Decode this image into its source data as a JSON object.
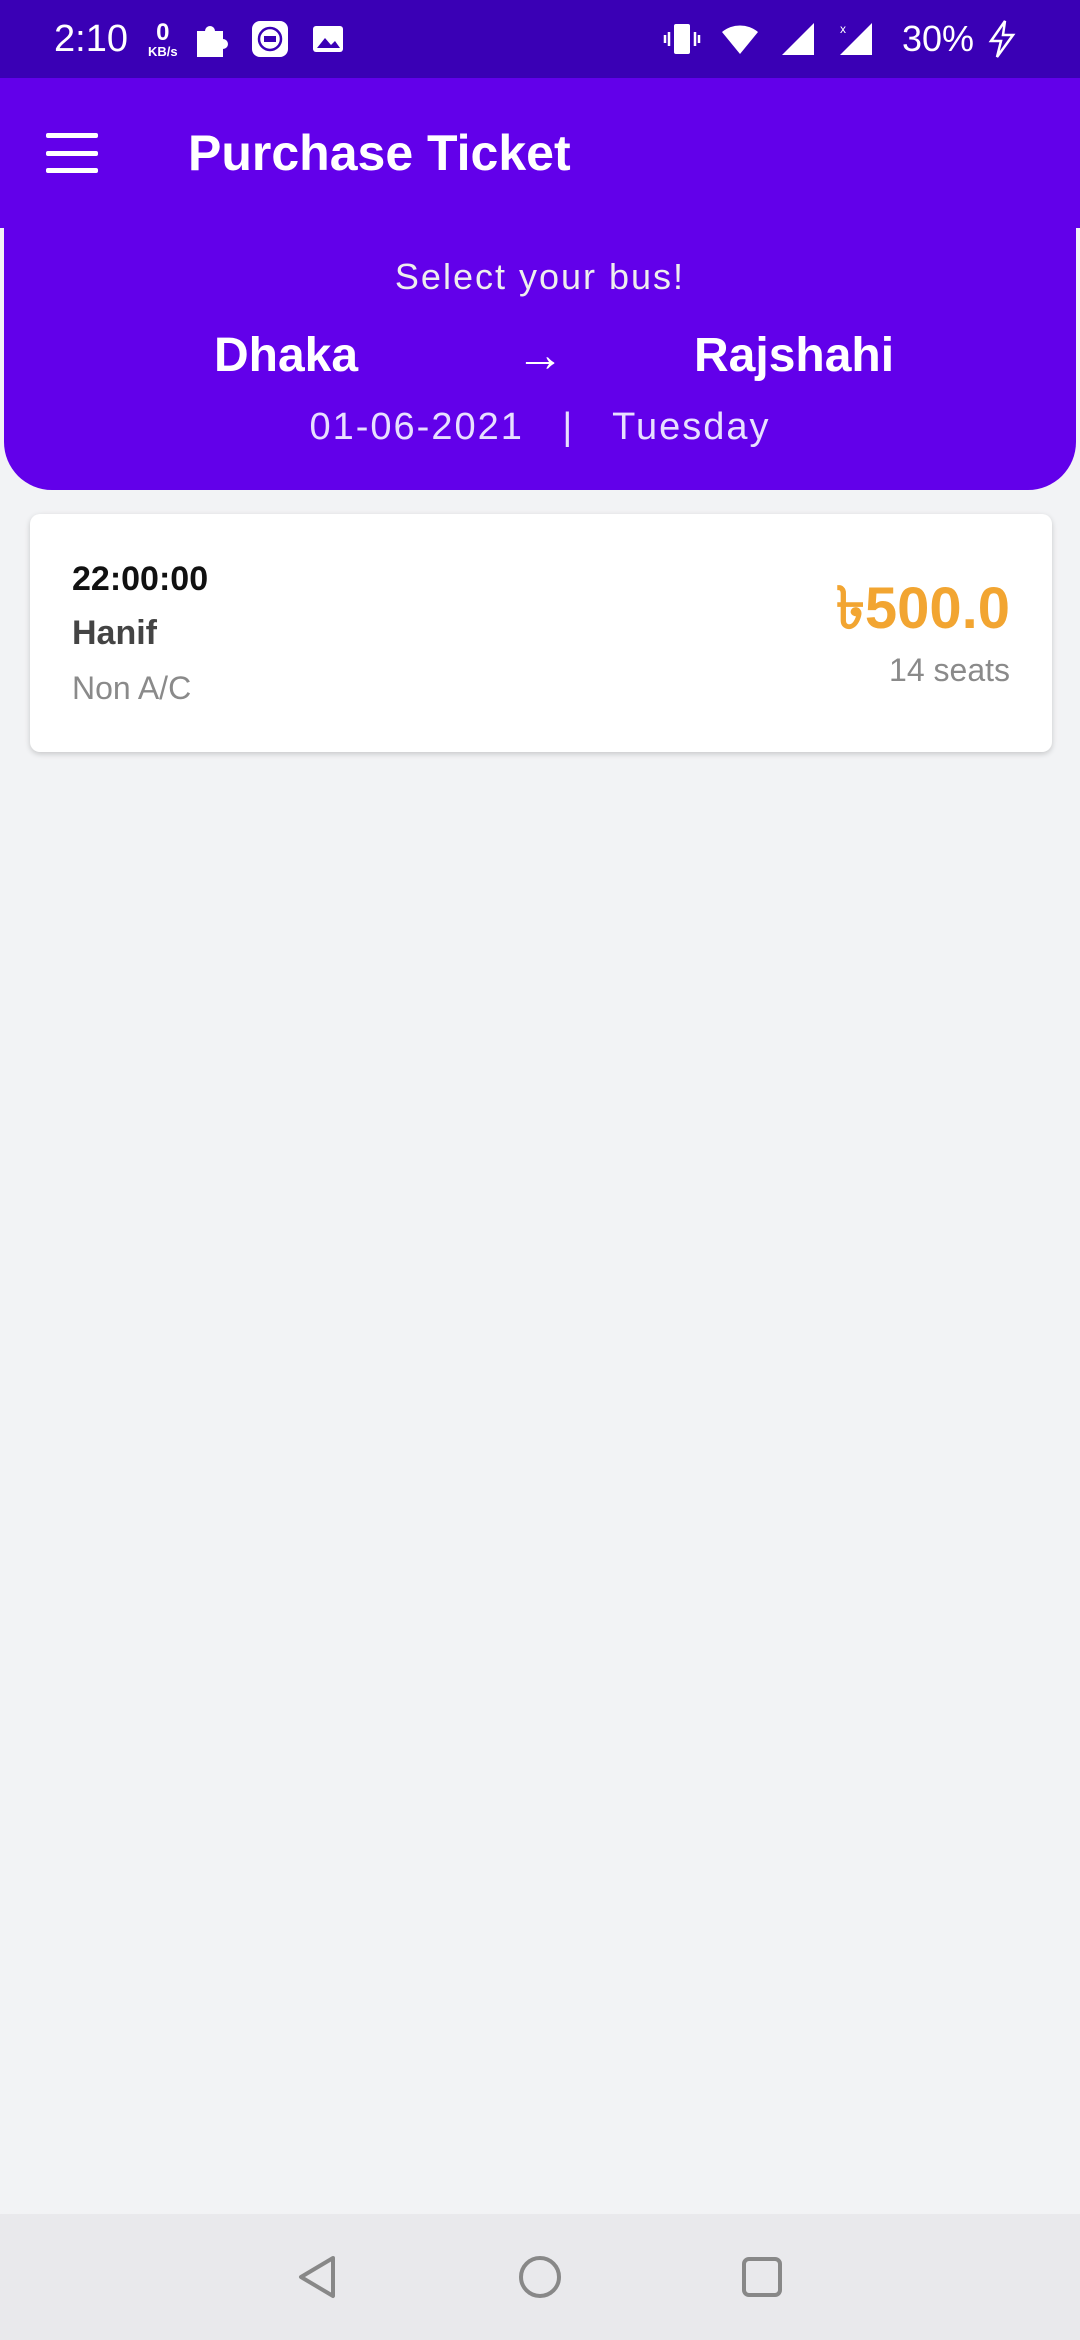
{
  "status_bar": {
    "time": "2:10",
    "speed_value": "0",
    "speed_unit": "KB/s",
    "battery": "30%"
  },
  "app_bar": {
    "title": "Purchase Ticket"
  },
  "header": {
    "subtitle": "Select your bus!",
    "from": "Dhaka",
    "arrow": "→",
    "to": "Rajshahi",
    "date": "01-06-2021",
    "separator": "|",
    "day": "Tuesday"
  },
  "buses": [
    {
      "time": "22:00:00",
      "name": "Hanif",
      "type": "Non A/C",
      "price": "৳500.0",
      "seats": "14 seats"
    }
  ],
  "colors": {
    "status_bar": "#3a00b5",
    "primary": "#6200ea",
    "price": "#f2a531",
    "background": "#f2f3f5"
  }
}
